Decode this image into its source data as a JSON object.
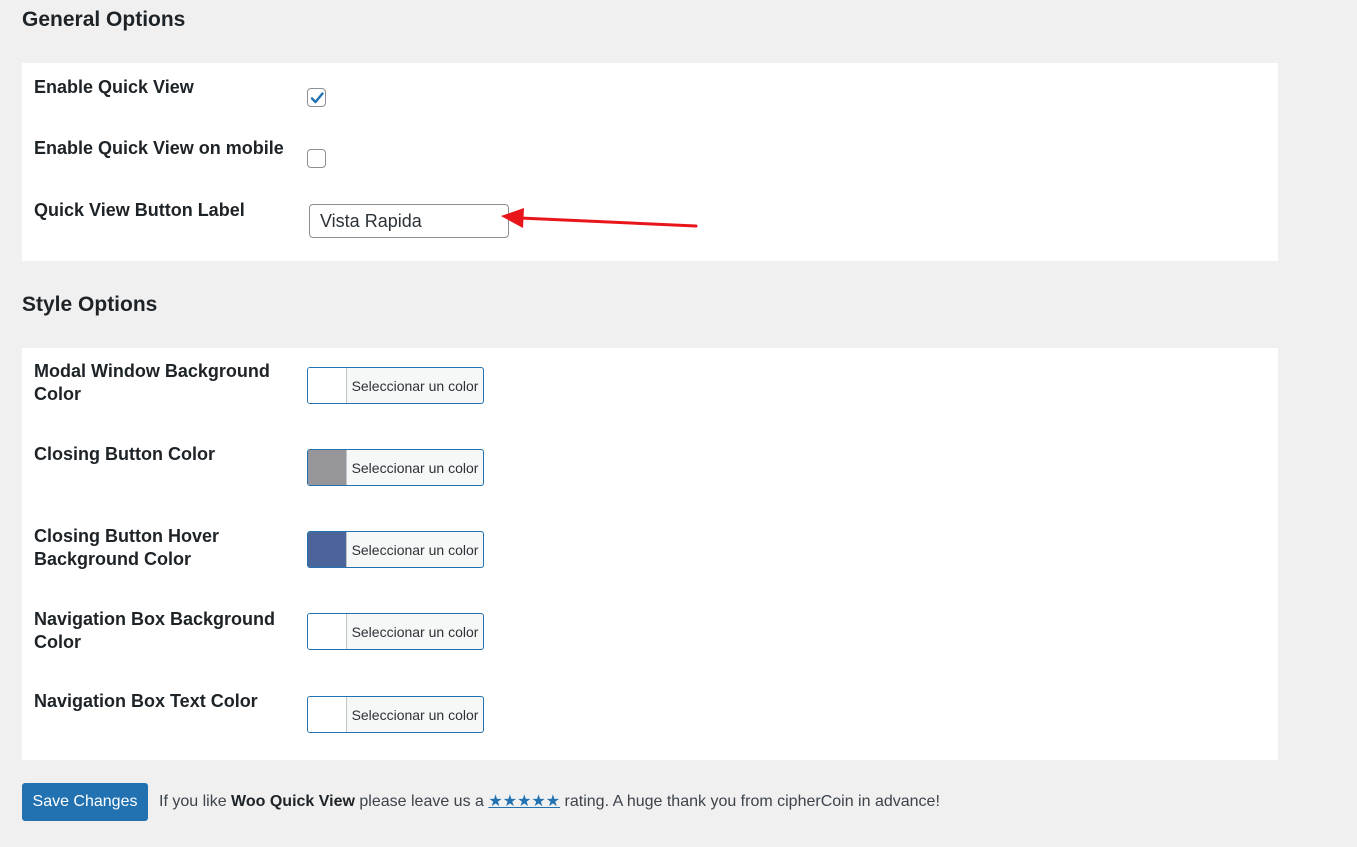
{
  "general": {
    "title": "General Options",
    "enable_quick_view": {
      "label": "Enable Quick View",
      "checked": true
    },
    "enable_mobile": {
      "label": "Enable Quick View on mobile",
      "checked": false
    },
    "button_label": {
      "label": "Quick View Button Label",
      "value": "Vista Rapida"
    }
  },
  "style": {
    "title": "Style Options",
    "button_text": "Seleccionar un color",
    "items": [
      {
        "label": "Modal Window Background Color",
        "swatch": "#ffffff"
      },
      {
        "label": "Closing Button Color",
        "swatch": "#95959a"
      },
      {
        "label": "Closing Button Hover Background Color",
        "swatch": "#4b649a"
      },
      {
        "label": "Navigation Box Background Color",
        "swatch": "#ffffff"
      },
      {
        "label": "Navigation Box Text Color",
        "swatch": "#ffffff"
      }
    ]
  },
  "footer": {
    "save_label": "Save Changes",
    "note_prefix": "If you like",
    "plugin_name": "Woo Quick View",
    "note_mid": "please leave us a",
    "stars": "★★★★★",
    "note_suffix": "rating. A huge thank you from cipherCoin in advance!"
  },
  "annotation": {
    "arrow_color": "#e8151b"
  }
}
